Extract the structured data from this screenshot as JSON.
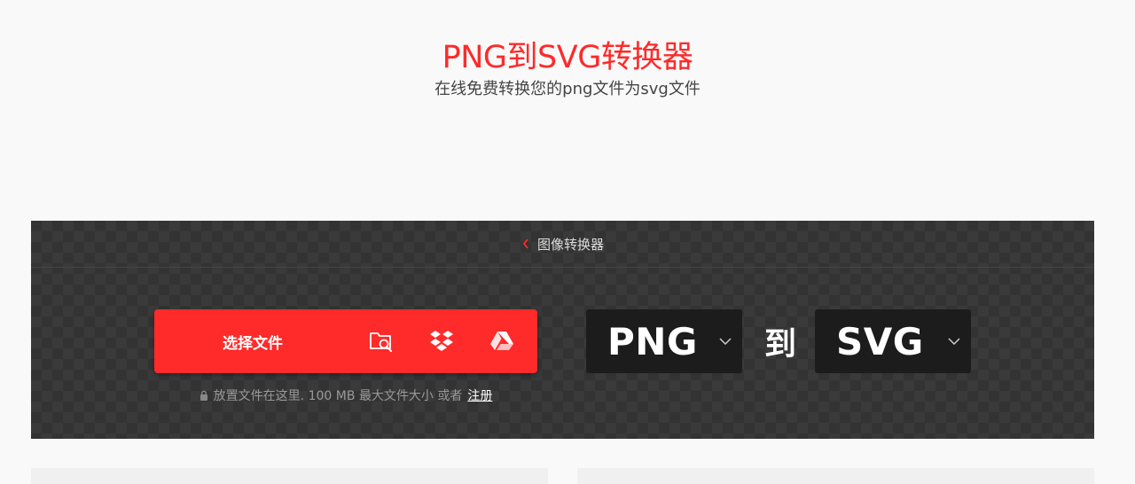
{
  "hero": {
    "title": "PNG到SVG转换器",
    "subtitle": "在线免费转换您的png文件为svg文件"
  },
  "breadcrumb": {
    "label": "图像转换器"
  },
  "upload": {
    "choose_label": "选择文件",
    "sources": [
      "folder-search-icon",
      "dropbox-icon",
      "google-drive-icon"
    ],
    "drop_note": "放置文件在这里. 100 MB 最大文件大小 或者",
    "signup_label": "注册"
  },
  "convert": {
    "from_format": "PNG",
    "to_label": "到",
    "to_format": "SVG"
  },
  "colors": {
    "accent": "#ff2a2a",
    "panel": "#333333",
    "select_bg": "#1c1c1c"
  }
}
